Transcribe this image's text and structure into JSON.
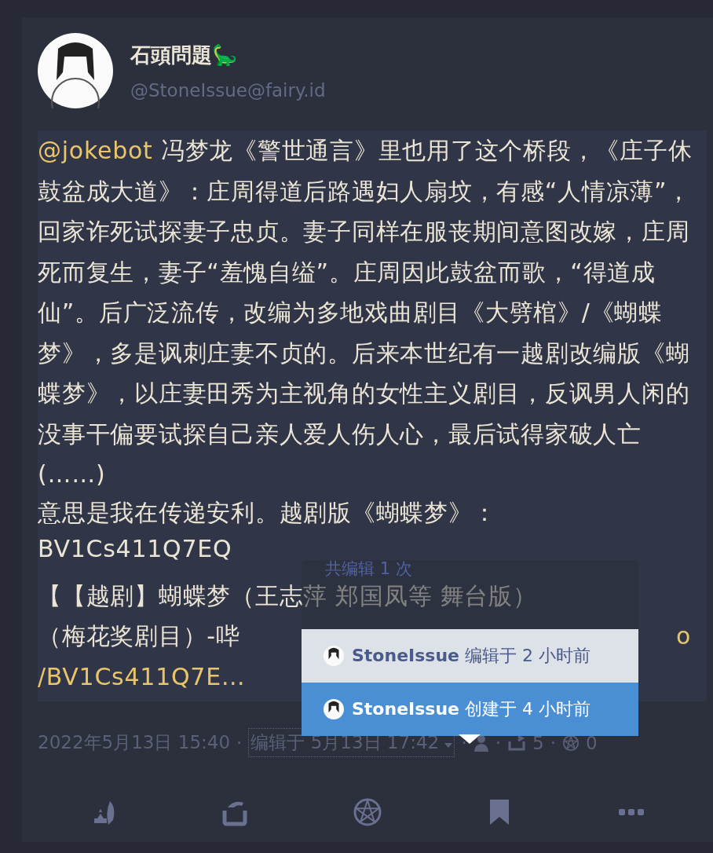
{
  "author": {
    "display_name": "石頭問題🦕",
    "handle": "@StoneIssue@fairy.id"
  },
  "content": {
    "mention": "@jokebot",
    "paragraphs": [
      "冯梦龙《警世通言》里也用了这个桥段，《庄子休鼓盆成大道》：庄周得道后路遇妇人扇坟，有感“人情凉薄”，回家诈死试探妻子忠贞。妻子同样在服丧期间意图改嫁，庄周死而复生，妻子“羞愧自缢”。庄周因此鼓盆而歌，“得道成仙”。后广泛流传，改编为多地戏曲剧目《大劈棺》/《蝴蝶梦》，多是讽刺庄妻不贞的。后来本世纪有一越剧改编版《蝴蝶梦》，以庄妻田秀为主视角的女性主义剧目，反讽男人闲的没事干偏要试探自己亲人爱人伤人心，最后试得家破人亡(……)",
      "意思是我在传递安利。越剧版《蝴蝶梦》：BV1Cs411Q7EQ",
      "【【越剧】蝴蝶梦（王志萍 郑国凤等 舞台版）"
    ],
    "cut_line": {
      "text": "（梅花奖剧目）-哔",
      "link_part": "o"
    },
    "link_line": "/BV1Cs411Q7E…"
  },
  "meta": {
    "separator": "·",
    "date": "2022年5月13日 15:40",
    "edited": "编辑于 5月13日 17:42",
    "replies": "5",
    "reactions": "0"
  },
  "edit_history": {
    "title": "共编辑 1 次",
    "items": [
      {
        "user": "StoneIssue",
        "action": "编辑于 2 小时前",
        "selected": false
      },
      {
        "user": "StoneIssue",
        "action": "创建于 4 小时前",
        "selected": true
      }
    ]
  },
  "actions": [
    {
      "kind": "reply"
    },
    {
      "kind": "renote"
    },
    {
      "kind": "react"
    },
    {
      "kind": "bookmark"
    },
    {
      "kind": "more"
    }
  ]
}
